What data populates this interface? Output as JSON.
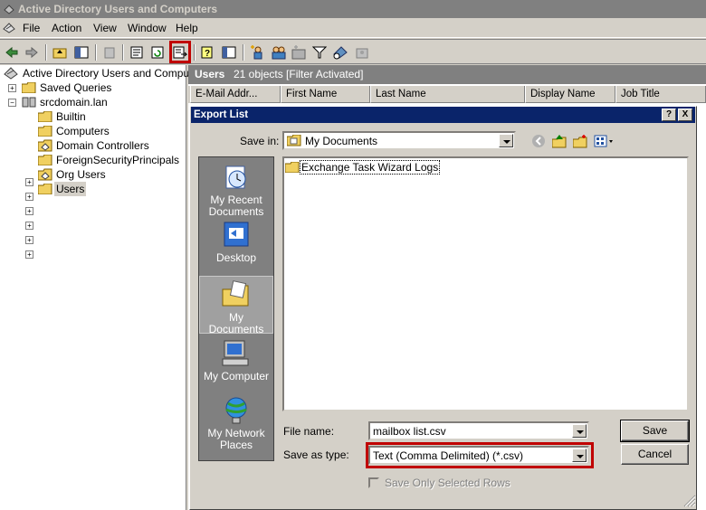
{
  "window": {
    "title": "Active Directory Users and Computers"
  },
  "menu": [
    "File",
    "Action",
    "View",
    "Window",
    "Help"
  ],
  "tree": {
    "root": "Active Directory Users and Computer",
    "items": [
      "Saved Queries",
      "srcdomain.lan",
      "Builtin",
      "Computers",
      "Domain Controllers",
      "ForeignSecurityPrincipals",
      "Org Users",
      "Users"
    ]
  },
  "right_pane": {
    "title": "Users",
    "status": "21 objects  [Filter Activated]",
    "columns": [
      "E-Mail Addr...",
      "First Name",
      "Last Name",
      "Display Name",
      "Job Title"
    ]
  },
  "dialog": {
    "title": "Export List",
    "help_btn": "?",
    "close_btn": "X",
    "save_in_label": "Save in:",
    "save_in_value": "My Documents",
    "places": [
      "My Recent Documents",
      "Desktop",
      "My Documents",
      "My Computer",
      "My Network Places"
    ],
    "files": [
      "Exchange Task Wizard Logs"
    ],
    "file_name_label": "File name:",
    "file_name_value": "mailbox list.csv",
    "save_as_type_label": "Save as type:",
    "save_as_type_value": "Text (Comma Delimited) (*.csv)",
    "save_button": "Save",
    "cancel_button": "Cancel",
    "checkbox_label": "Save Only Selected Rows"
  },
  "colors": {
    "dialog_title_bg": "#0a246a",
    "highlight": "#c00000"
  }
}
